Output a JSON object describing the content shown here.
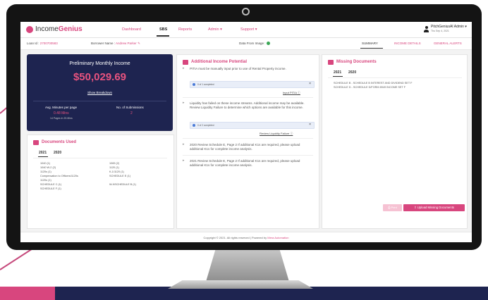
{
  "app": {
    "logo_prefix": "Income",
    "logo_brand": "Genius"
  },
  "nav": {
    "items": [
      {
        "label": "Dashboard",
        "active": false
      },
      {
        "label": "SBS",
        "active": true
      },
      {
        "label": "Reports",
        "active": false
      },
      {
        "label": "Admin ▾",
        "active": false
      },
      {
        "label": "Support ▾",
        "active": false
      }
    ],
    "user_name": "PitchGeniusAI Admin ▾",
    "user_date": "Thu Sep 4, 2021"
  },
  "subbar": {
    "loan_label": "Loan Id :",
    "loan_value": "2700700583",
    "borrower_label": "Borrower Name :",
    "borrower_value": "Andrew Parker",
    "data_image_label": "Data From Image :",
    "tabs": [
      {
        "label": "SUMMARY",
        "active": true
      },
      {
        "label": "INCOME DETAILS",
        "active": false
      },
      {
        "label": "GENERAL ALERTS",
        "active": false
      }
    ]
  },
  "income": {
    "title": "Preliminary Monthly Income",
    "value": "$50,029.69",
    "breakdown_link": "Show Breakdown",
    "avg_label": "Avg. Minutes per page",
    "avg_value": "0.48 Mins",
    "avg_sub": "14 Pages in 20.Mins",
    "submissions_label": "No. of Submissions",
    "submissions_value": "2"
  },
  "documents_used": {
    "title": "Documents Used",
    "years": [
      "2021",
      "2020"
    ],
    "col1": [
      "1040 (1)",
      "1040 W-2 (2)",
      "1120s (1)",
      "Compensation to Officers/1120s",
      "1120s (1)",
      "SCHEDULE C (1)",
      "SCHEDULE F (1)"
    ],
    "col2": [
      "1065 (2)",
      "1120 (1)",
      "K-1/1120 (1)",
      "SCHEDULE E (1)",
      "",
      "W-9/SCHEDULE B (1)",
      ""
    ]
  },
  "additional_income": {
    "title": "Additional Income Potential",
    "alerts": [
      {
        "text": "PITIA must be manually input prior to use of Rental Property income.",
        "progress": "0 of 1 completed",
        "link": "Input PITIA ⓘ"
      },
      {
        "text": "Liquidity has failed on these income streams. Additional income may be available. Review Liquidity Failure to determine which options are available for this income.",
        "progress": "0 of 2 completed",
        "link": "Review Liquidity Failure ⓘ"
      },
      {
        "text": "2020 Review Schedule E, Page 2 If additional K1s are required, please upload additional K1s for complete income analysis.",
        "progress": "",
        "link": ""
      },
      {
        "text": "2021 Review Schedule E, Page 2 If additional K1s are required, please upload additional K1s for complete income analysis.",
        "progress": "",
        "link": ""
      }
    ]
  },
  "missing_documents": {
    "title": "Missing Documents",
    "years": [
      "2021",
      "2020"
    ],
    "items": [
      "SCHEDULE B - SCHEDULE B INTEREST AND DIVIDEND SET F",
      "SCHEDULE D - SCHEDULE D/FORM 8949 INCOME SET F"
    ],
    "print_label": "Print",
    "upload_label": "⇪ Upload Missing Documents"
  },
  "footer": {
    "text": "Copyright © 2021. All rights reserved | Powered by",
    "brand": "Mera Automation"
  },
  "colors": {
    "accent": "#d8467e",
    "navy": "#1e2450",
    "success": "#3aa655"
  }
}
